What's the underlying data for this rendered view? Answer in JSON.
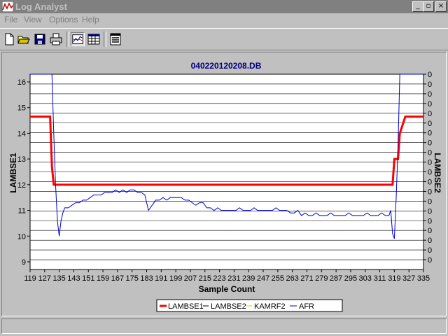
{
  "app": {
    "title": "Log Analyst"
  },
  "menu": [
    "File",
    "View",
    "Options",
    "Help"
  ],
  "toolbar": {
    "buttons": [
      "new-file-icon",
      "open-folder-icon",
      "save-disk-icon",
      "print-icon",
      "chart-view-icon",
      "table-view-icon",
      "list-view-icon"
    ]
  },
  "chart_data": {
    "type": "line",
    "title": "040220120208.DB",
    "xlabel": "Sample Count",
    "ylabel": "LAMBSE1",
    "y2label": "LAMBSE2",
    "xlim": [
      119,
      335
    ],
    "ylim": [
      8.7,
      16.3
    ],
    "x_ticks": [
      "119",
      "127",
      "135",
      "143",
      "151",
      "159",
      "167",
      "175",
      "183",
      "191",
      "199",
      "207",
      "215",
      "223",
      "231",
      "239",
      "247",
      "255",
      "263",
      "271",
      "279",
      "287",
      "295",
      "303",
      "311",
      "319",
      "327",
      "335"
    ],
    "y_ticks": [
      "9",
      "10",
      "11",
      "12",
      "13",
      "14",
      "15",
      "16"
    ],
    "y2_ticks": [
      "0",
      "0",
      "0",
      "0",
      "0",
      "0",
      "0",
      "0",
      "0",
      "0",
      "0",
      "0",
      "0",
      "0",
      "0",
      "0",
      "0",
      "0",
      "0",
      "0"
    ],
    "legend": [
      "LAMBSE1",
      "LAMBSE2",
      "KAMRF2",
      "AFR"
    ],
    "legend_position": "bottom",
    "grid": true,
    "series": [
      {
        "name": "LAMBSE1",
        "color": "#ff0000",
        "x": [
          119,
          130,
          131,
          132,
          133,
          318,
          319,
          321,
          322,
          325,
          335
        ],
        "y": [
          14.65,
          14.65,
          12.7,
          12.0,
          12.0,
          12.0,
          13.0,
          13.0,
          14.0,
          14.65,
          14.65
        ]
      },
      {
        "name": "LAMBSE2",
        "color": "#000000",
        "x": [],
        "y": []
      },
      {
        "name": "KAMRF2",
        "color": "#ffff00",
        "x": [],
        "y": []
      },
      {
        "name": "AFR",
        "color": "#0000cc",
        "x": [
          119,
          131,
          132,
          133,
          134,
          135,
          136,
          137,
          138,
          140,
          142,
          144,
          146,
          148,
          150,
          152,
          154,
          156,
          158,
          160,
          162,
          164,
          166,
          168,
          170,
          172,
          174,
          176,
          178,
          180,
          182,
          184,
          186,
          188,
          190,
          192,
          194,
          196,
          198,
          200,
          202,
          204,
          206,
          208,
          210,
          212,
          214,
          216,
          218,
          220,
          222,
          224,
          226,
          228,
          230,
          232,
          234,
          236,
          238,
          240,
          242,
          244,
          246,
          248,
          250,
          252,
          254,
          256,
          258,
          260,
          262,
          264,
          266,
          268,
          270,
          272,
          274,
          276,
          278,
          280,
          282,
          284,
          286,
          288,
          290,
          292,
          294,
          296,
          298,
          300,
          302,
          304,
          306,
          308,
          310,
          312,
          314,
          316,
          317,
          318,
          319,
          320,
          321,
          322,
          335
        ],
        "y": [
          16.3,
          16.3,
          14.0,
          12.0,
          10.6,
          10.0,
          10.6,
          10.9,
          11.1,
          11.1,
          11.2,
          11.3,
          11.3,
          11.4,
          11.4,
          11.5,
          11.6,
          11.6,
          11.6,
          11.7,
          11.7,
          11.7,
          11.8,
          11.7,
          11.8,
          11.7,
          11.8,
          11.8,
          11.7,
          11.7,
          11.6,
          11.0,
          11.2,
          11.4,
          11.4,
          11.5,
          11.4,
          11.5,
          11.5,
          11.5,
          11.5,
          11.4,
          11.4,
          11.3,
          11.2,
          11.3,
          11.3,
          11.1,
          11.1,
          11.0,
          11.1,
          11.0,
          11.0,
          11.0,
          11.0,
          11.0,
          11.1,
          11.0,
          11.0,
          11.0,
          11.1,
          11.0,
          11.0,
          11.0,
          11.0,
          11.0,
          11.1,
          11.0,
          11.0,
          11.0,
          10.9,
          10.9,
          11.0,
          10.8,
          10.9,
          10.8,
          10.8,
          10.9,
          10.8,
          10.8,
          10.8,
          10.9,
          10.8,
          10.8,
          10.8,
          10.8,
          10.9,
          10.8,
          10.8,
          10.8,
          10.8,
          10.9,
          10.8,
          10.8,
          10.8,
          10.9,
          10.8,
          10.8,
          11.0,
          10.1,
          9.9,
          11.5,
          13.5,
          16.3,
          16.3
        ]
      }
    ]
  }
}
